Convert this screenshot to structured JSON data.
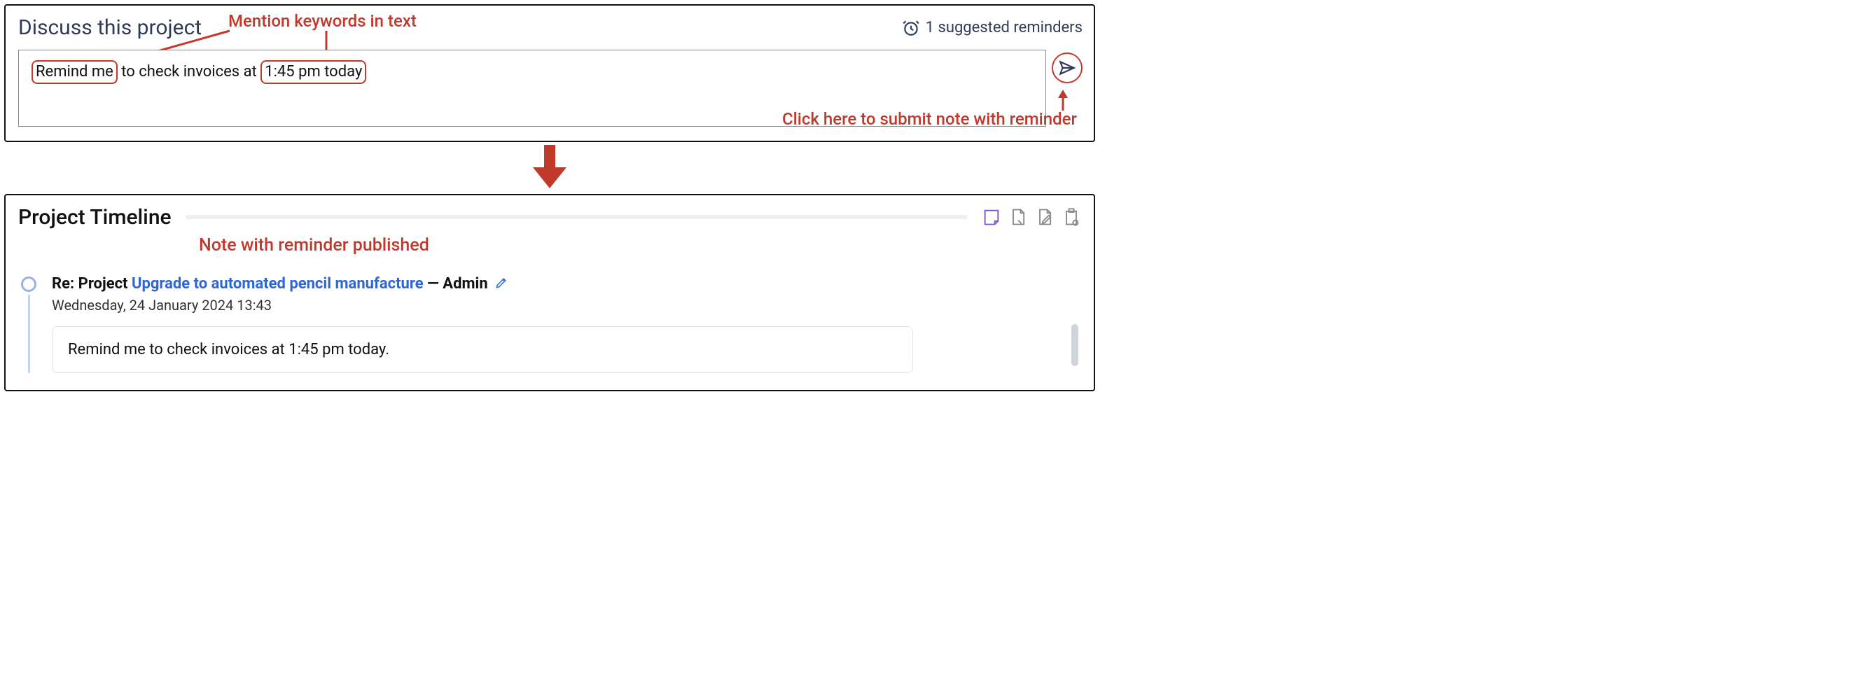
{
  "discuss": {
    "title": "Discuss this project",
    "reminders_label": "1 suggested reminders",
    "note_parts": {
      "kw1": "Remind me",
      "mid": " to check invoices at ",
      "kw2": "1:45 pm today"
    }
  },
  "annotations": {
    "keywords": "Mention keywords in text",
    "submit": "Click here to submit note with reminder",
    "published": "Note with reminder published"
  },
  "timeline": {
    "title": "Project Timeline",
    "entry": {
      "prefix": "Re: Project ",
      "link": "Upgrade to automated pencil manufacture",
      "dash": " — ",
      "author": "Admin",
      "date": "Wednesday, 24 January 2024 13:43",
      "body": "Remind me to check invoices at 1:45 pm today."
    }
  }
}
